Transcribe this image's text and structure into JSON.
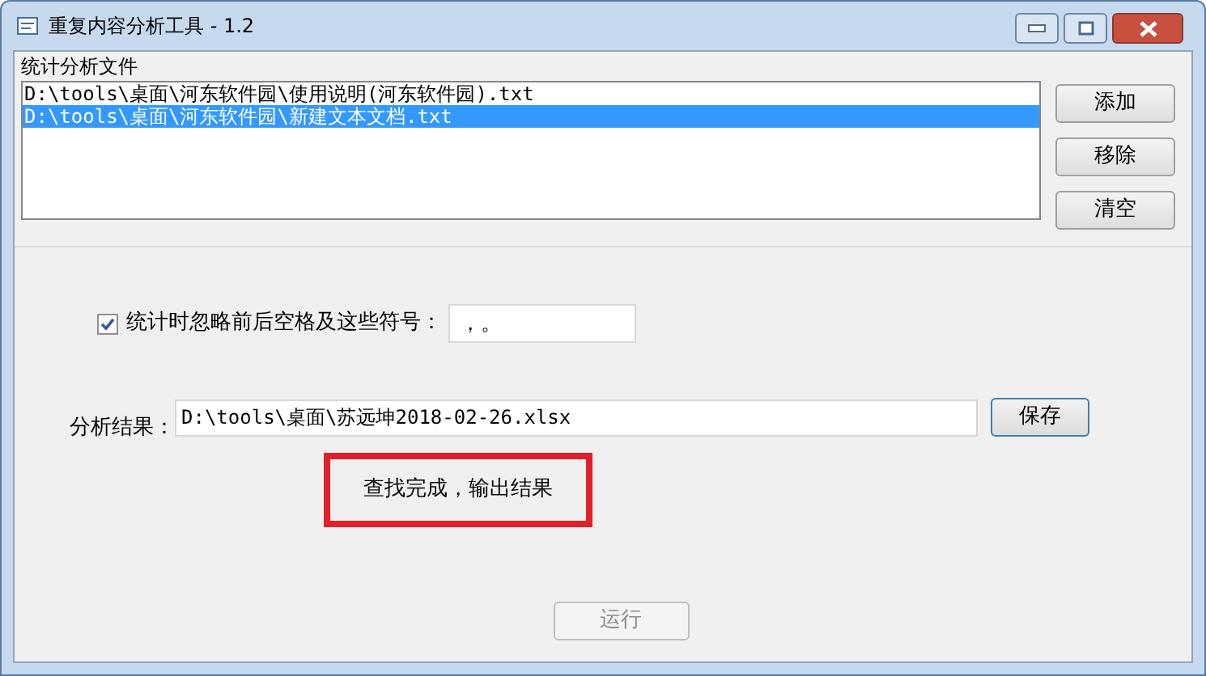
{
  "window": {
    "title": "重复内容分析工具 - 1.2"
  },
  "files_group": {
    "label": "统计分析文件",
    "files": [
      {
        "path": "D:\\tools\\桌面\\河东软件园\\使用说明(河东软件园).txt",
        "selected": false
      },
      {
        "path": "D:\\tools\\桌面\\河东软件园\\新建文本文档.txt",
        "selected": true
      }
    ],
    "buttons": [
      "添加",
      "移除",
      "清空"
    ]
  },
  "ignore_option": {
    "label": "统计时忽略前后空格及这些符号：",
    "checked": true,
    "value": "，。"
  },
  "result": {
    "label": "分析结果：",
    "value": "D:\\tools\\桌面\\苏远坤2018-02-26.xlsx",
    "save_button": "保存"
  },
  "status": {
    "text": "查找完成，输出结果",
    "highlighted": true
  },
  "run_button": {
    "label": "运行",
    "disabled": true
  }
}
